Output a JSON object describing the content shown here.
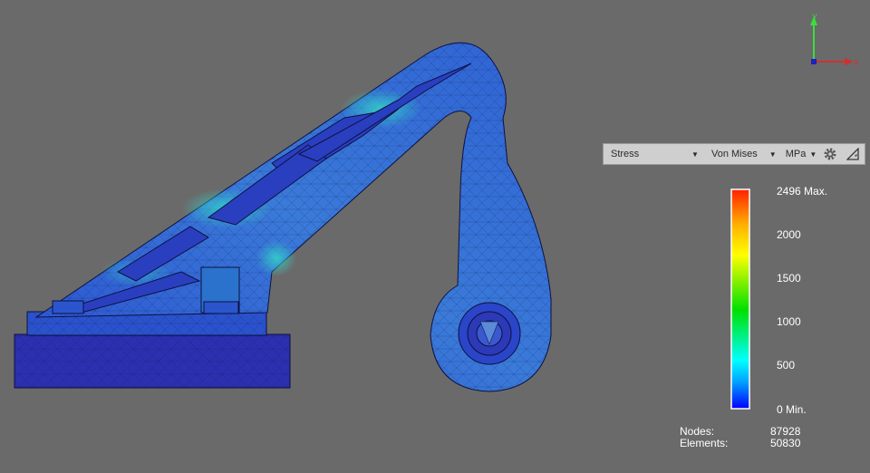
{
  "toolbar": {
    "result_type": "Stress",
    "component": "Von Mises",
    "unit": "MPa",
    "settings_icon": "gear-icon",
    "legend_toggle_icon": "triangle-ruler-icon"
  },
  "triad": {
    "y_label": "Y",
    "x_label": "X",
    "y_color": "#3ddc3d",
    "x_color": "#d03030",
    "z_color": "#2020c0"
  },
  "legend": {
    "labels": [
      "2496 Max.",
      "2000",
      "1500",
      "1000",
      "500",
      "0 Min."
    ],
    "colors": [
      "#ff2000",
      "#ffb000",
      "#ffff00",
      "#00e000",
      "#00ffff",
      "#00a0ff",
      "#0000ff"
    ]
  },
  "mesh_stats": {
    "nodes_label": "Nodes:",
    "nodes_value": "87928",
    "elements_label": "Elements:",
    "elements_value": "50830"
  }
}
